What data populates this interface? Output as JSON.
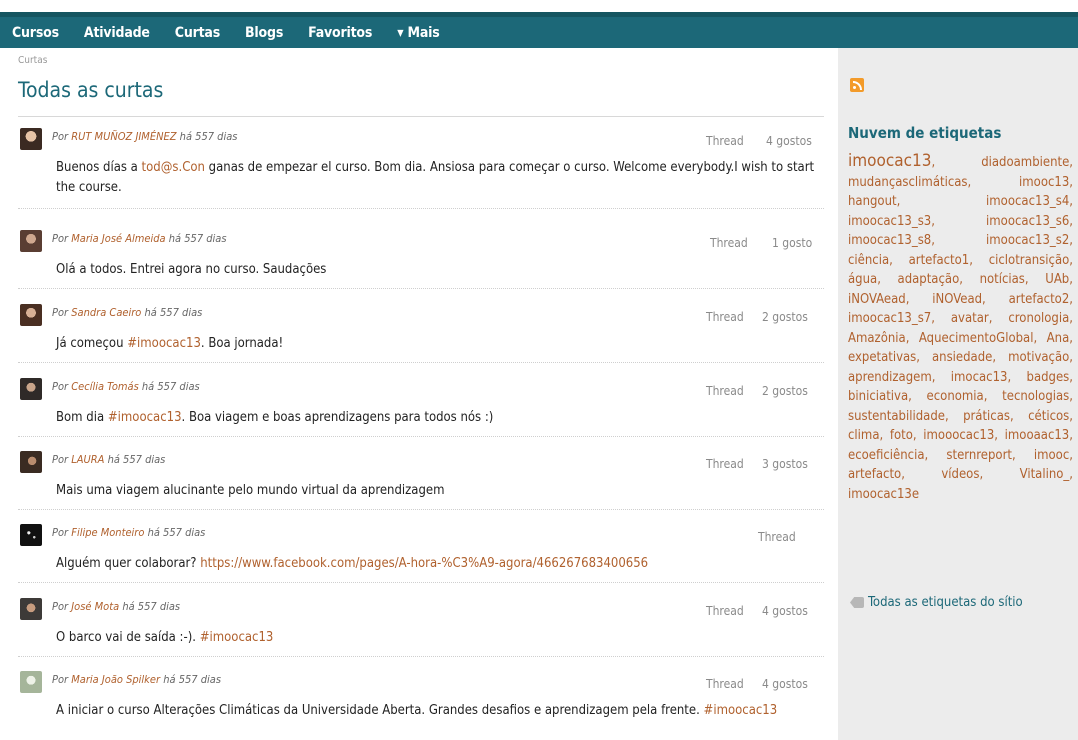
{
  "nav": {
    "items": [
      "Cursos",
      "Atividade",
      "Curtas",
      "Blogs",
      "Favoritos",
      "▾ Mais"
    ]
  },
  "main": {
    "breadcrumb": "Curtas",
    "title": "Todas as curtas"
  },
  "posts": [
    {
      "prefix": "Por",
      "author": "RUT MUÑOZ JIMÉNEZ",
      "time": "há 557 dias",
      "thread": "Thread",
      "likes": "4 gostos",
      "body_before": "Buenos días a ",
      "body_link": "tod@s.Con",
      "body_after": " ganas de empezar el curso. Bom dia. Ansiosa para começar o curso. Welcome everybody.I wish to start the course."
    },
    {
      "prefix": "Por",
      "author": "Maria José Almeida",
      "time": "há 557 dias",
      "thread": "Thread",
      "likes": "1 gosto",
      "body_before": "Olá a todos. Entrei agora no curso. Saudações",
      "body_link": "",
      "body_after": ""
    },
    {
      "prefix": "Por",
      "author": "Sandra Caeiro",
      "time": "há 557 dias",
      "thread": "Thread",
      "likes": "2 gostos",
      "body_before": "Já começou ",
      "body_link": "#imoocac13",
      "body_after": ". Boa jornada!"
    },
    {
      "prefix": "Por",
      "author": "Cecília Tomás",
      "time": "há 557 dias",
      "thread": "Thread",
      "likes": "2 gostos",
      "body_before": "Bom dia ",
      "body_link": "#imoocac13",
      "body_after": ". Boa viagem e boas aprendizagens para todos nós :)"
    },
    {
      "prefix": "Por",
      "author": "LAURA",
      "time": "há 557 dias",
      "thread": "Thread",
      "likes": "3 gostos",
      "body_before": "Mais uma viagem alucinante pelo mundo virtual da aprendizagem",
      "body_link": "",
      "body_after": ""
    },
    {
      "prefix": "Por",
      "author": "Filipe Monteiro",
      "time": "há 557 dias",
      "thread": "Thread",
      "likes": "",
      "body_before": "Alguém quer colaborar? ",
      "body_link": "https://www.facebook.com/pages/A-hora-%C3%A9-agora/466267683400656",
      "body_after": ""
    },
    {
      "prefix": "Por",
      "author": "José Mota",
      "time": "há 557 dias",
      "thread": "Thread",
      "likes": "4 gostos",
      "body_before": "O barco vai de saída :-). ",
      "body_link": "#imoocac13",
      "body_after": ""
    },
    {
      "prefix": "Por",
      "author": "Maria João Spilker",
      "time": "há 557 dias",
      "thread": "Thread",
      "likes": "4 gostos",
      "body_before": "A iniciar o curso Alterações Climáticas da Universidade Aberta. Grandes desafios e aprendizagem pela frente. ",
      "body_link": "#imoocac13",
      "body_after": ""
    }
  ],
  "sidebar": {
    "cloud_title": "Nuvem de etiquetas",
    "tags": [
      "imoocac13",
      "diadoambiente",
      "mudançasclimáticas",
      "imooc13",
      "hangout",
      "imoocac13_s4",
      "imoocac13_s3",
      "imoocac13_s6",
      "imoocac13_s8",
      "imoocac13_s2",
      "ciência",
      "artefacto1",
      "ciclotransição",
      "água",
      "adaptação",
      "notícias",
      "UAb",
      "iNOVAead",
      "iNOVead",
      "artefacto2",
      "imoocac13_s7",
      "avatar",
      "cronologia",
      "Amazônia",
      "AquecimentoGlobal",
      "Ana",
      "expetativas",
      "ansiedade",
      "motivação",
      "aprendizagem",
      "imocac13",
      "badges",
      "biniciativa",
      "economia",
      "tecnologias",
      "sustentabilidade",
      "práticas",
      "céticos",
      "clima",
      "foto",
      "imooocac13",
      "imooaac13",
      "ecoeficiência",
      "sternreport",
      "imooc",
      "artefacto",
      "vídeos",
      "Vitalino_",
      "imoocac13e"
    ],
    "all_tags_label": "Todas as etiquetas do sítio"
  },
  "colors": {
    "nav_bg": "#1c6878",
    "accent_link": "#b0612e",
    "sidebar_bg": "#ececec"
  }
}
